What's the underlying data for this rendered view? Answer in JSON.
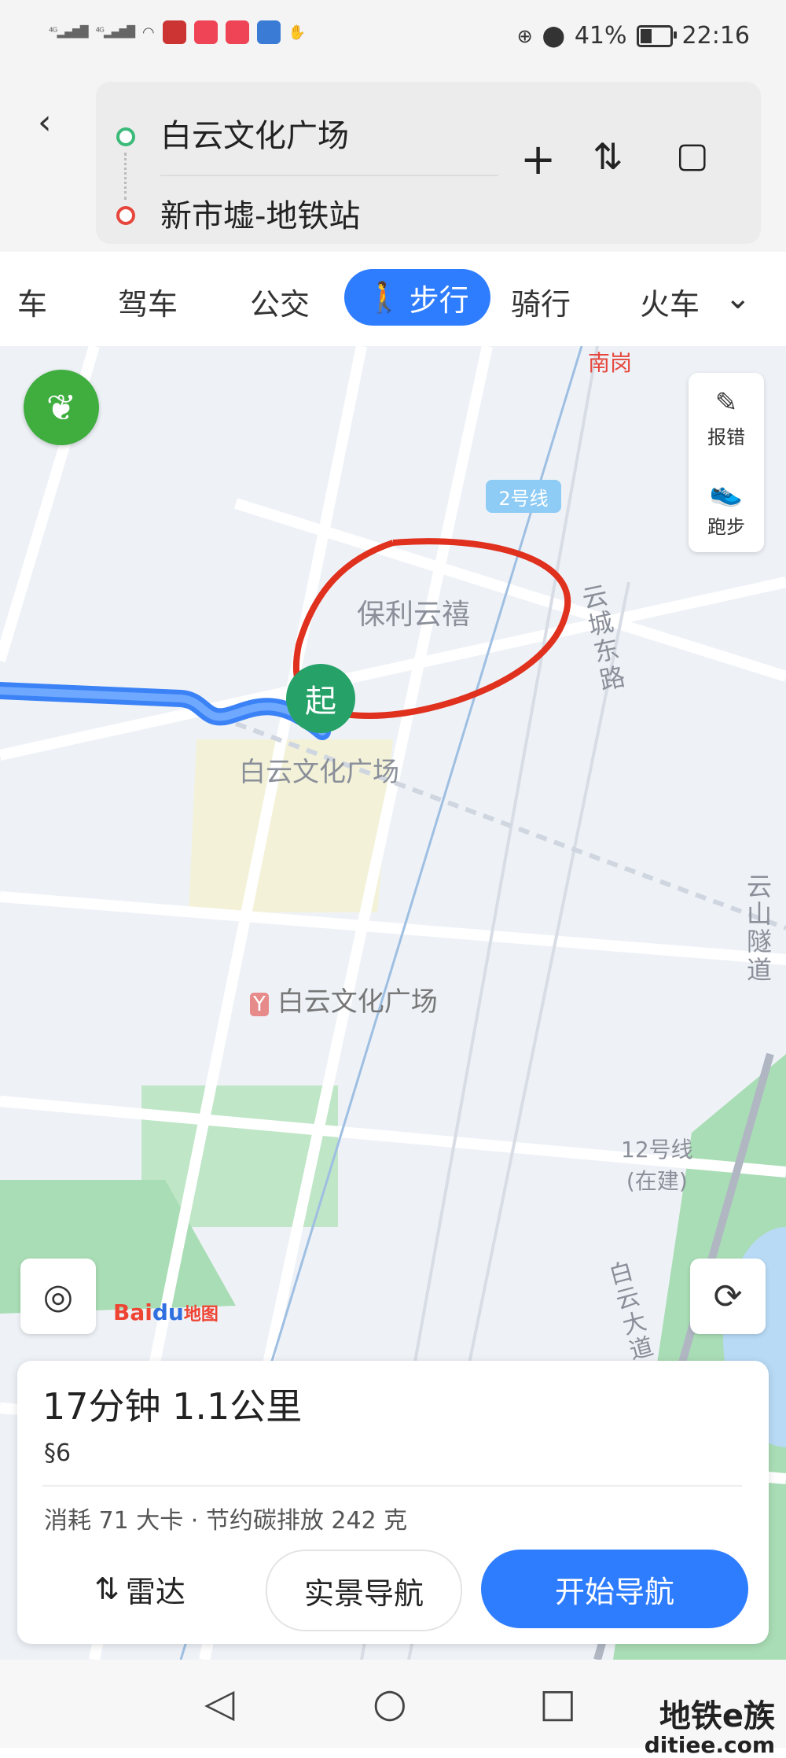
{
  "status_bar": {
    "battery": "41%",
    "time": "22:16",
    "battery_level": 0.41
  },
  "route": {
    "from": "白云文化广场",
    "to": "新市墟-地铁站"
  },
  "tabs": [
    {
      "label": "车"
    },
    {
      "label": "驾车"
    },
    {
      "label": "公交"
    },
    {
      "label": "步行",
      "active": true
    },
    {
      "label": "骑行"
    },
    {
      "label": "火车"
    }
  ],
  "map": {
    "labels": {
      "metro_top": "南岗",
      "line2": "2号线",
      "poly": "保利云禧",
      "road_yuncheng": "云城东路",
      "start_place": "白云文化广场",
      "station": "白云文化广场",
      "tunnel": "云山隧道",
      "line12": "12号线\n(在建)",
      "baiyun_road": "白云大道"
    },
    "start_marker": "起",
    "side_buttons": {
      "report": "报错",
      "run": "跑步"
    },
    "logo": {
      "brand": "Bai",
      "du": "du",
      "suffix": "地图"
    }
  },
  "summary": {
    "duration_distance": "17分钟  1.1公里",
    "traffic_lights": "6",
    "stats": "消耗 71 大卡  ·  节约碳排放 242 克"
  },
  "buttons": {
    "radar": "雷达",
    "live_nav": "实景导航",
    "start_nav": "开始导航"
  },
  "watermark": {
    "title": "地铁e族",
    "site": "ditiee.com"
  },
  "colors": {
    "accent": "#2f7dff",
    "start": "#26a269",
    "annotation": "#e0301e"
  }
}
